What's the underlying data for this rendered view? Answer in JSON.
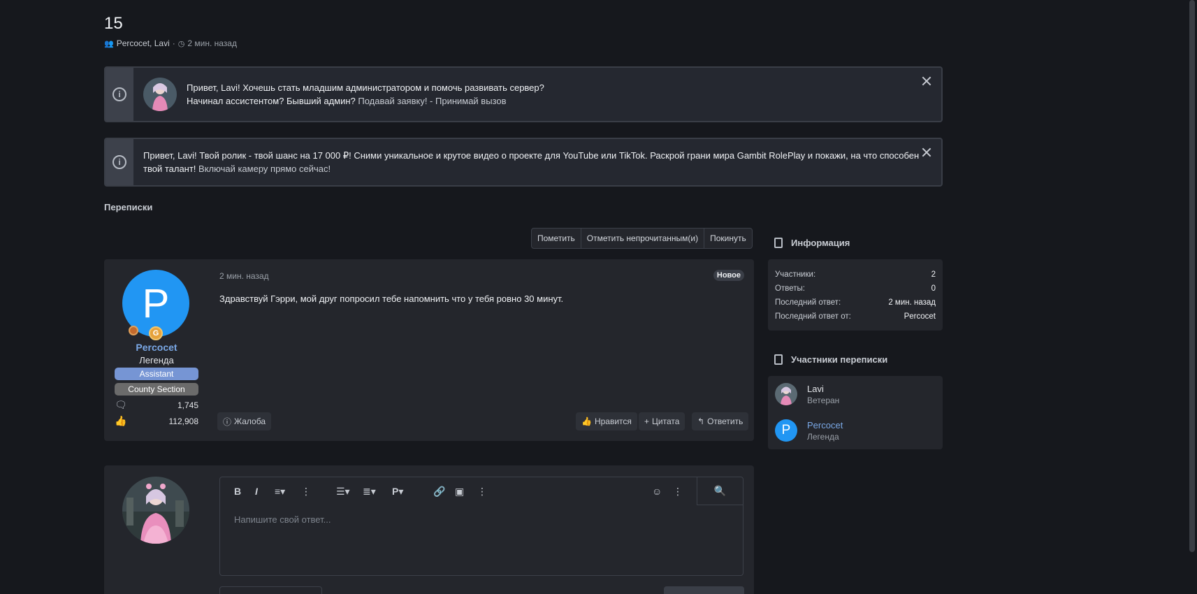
{
  "page": {
    "title": "15",
    "participants": "Percocet, Lavi",
    "separator": "·",
    "time": "2 мин. назад"
  },
  "notices": [
    {
      "line1": "Привет, Lavi! Хочешь стать младшим администратором и помочь развивать сервер?",
      "line2_prefix": "Начинал ассистентом? Бывший админ? ",
      "line2_link": "Подавай заявку! - Принимай вызов"
    },
    {
      "line1": "Привет, Lavi! Твой ролик - твой шанс на 17 000 ₽! Сними уникальное и крутое видео о проекте для YouTube или TikTok. Раскрой грани мира Gambit RolePlay и покажи, на что способен",
      "line2_prefix": "твой талант! ",
      "line2_link": "Включай камеру прямо сейчас!"
    }
  ],
  "section_title": "Переписки",
  "actions": {
    "mark": "Пометить",
    "mark_unread": "Отметить непрочитанным(и)",
    "leave": "Покинуть"
  },
  "message": {
    "avatar_letter": "P",
    "username": "Percocet",
    "user_title": "Легенда",
    "roles": [
      "Assistant",
      "County Section"
    ],
    "messages_count": "1,745",
    "likes_count": "112,908",
    "time": "2 мин. назад",
    "new_badge": "Новое",
    "text": "Здравствуй Гэрри, мой друг попросил тебе напомнить что у тебя ровно 30 минут.",
    "report": "Жалоба",
    "like": "Нравится",
    "quote": "Цитата",
    "reply": "Ответить"
  },
  "info": {
    "title": "Информация",
    "rows": [
      {
        "k": "Участники:",
        "v": "2"
      },
      {
        "k": "Ответы:",
        "v": "0"
      },
      {
        "k": "Последний ответ:",
        "v": "2 мин. назад"
      },
      {
        "k": "Последний ответ от:",
        "v": "Percocet"
      }
    ]
  },
  "participants": {
    "title": "Участники переписки",
    "list": [
      {
        "name": "Lavi",
        "title": "Ветеран"
      },
      {
        "name": "Percocet",
        "title": "Легенда",
        "letter": "P"
      }
    ]
  },
  "editor": {
    "placeholder": "Напишите свой ответ..."
  },
  "colors": {
    "background": "#16181d",
    "panel": "#24262c",
    "accent_blue": "#2196f3",
    "link_blue": "#7aa8e6",
    "role_assistant": "#7695d4",
    "role_county": "#6b6b6b"
  }
}
